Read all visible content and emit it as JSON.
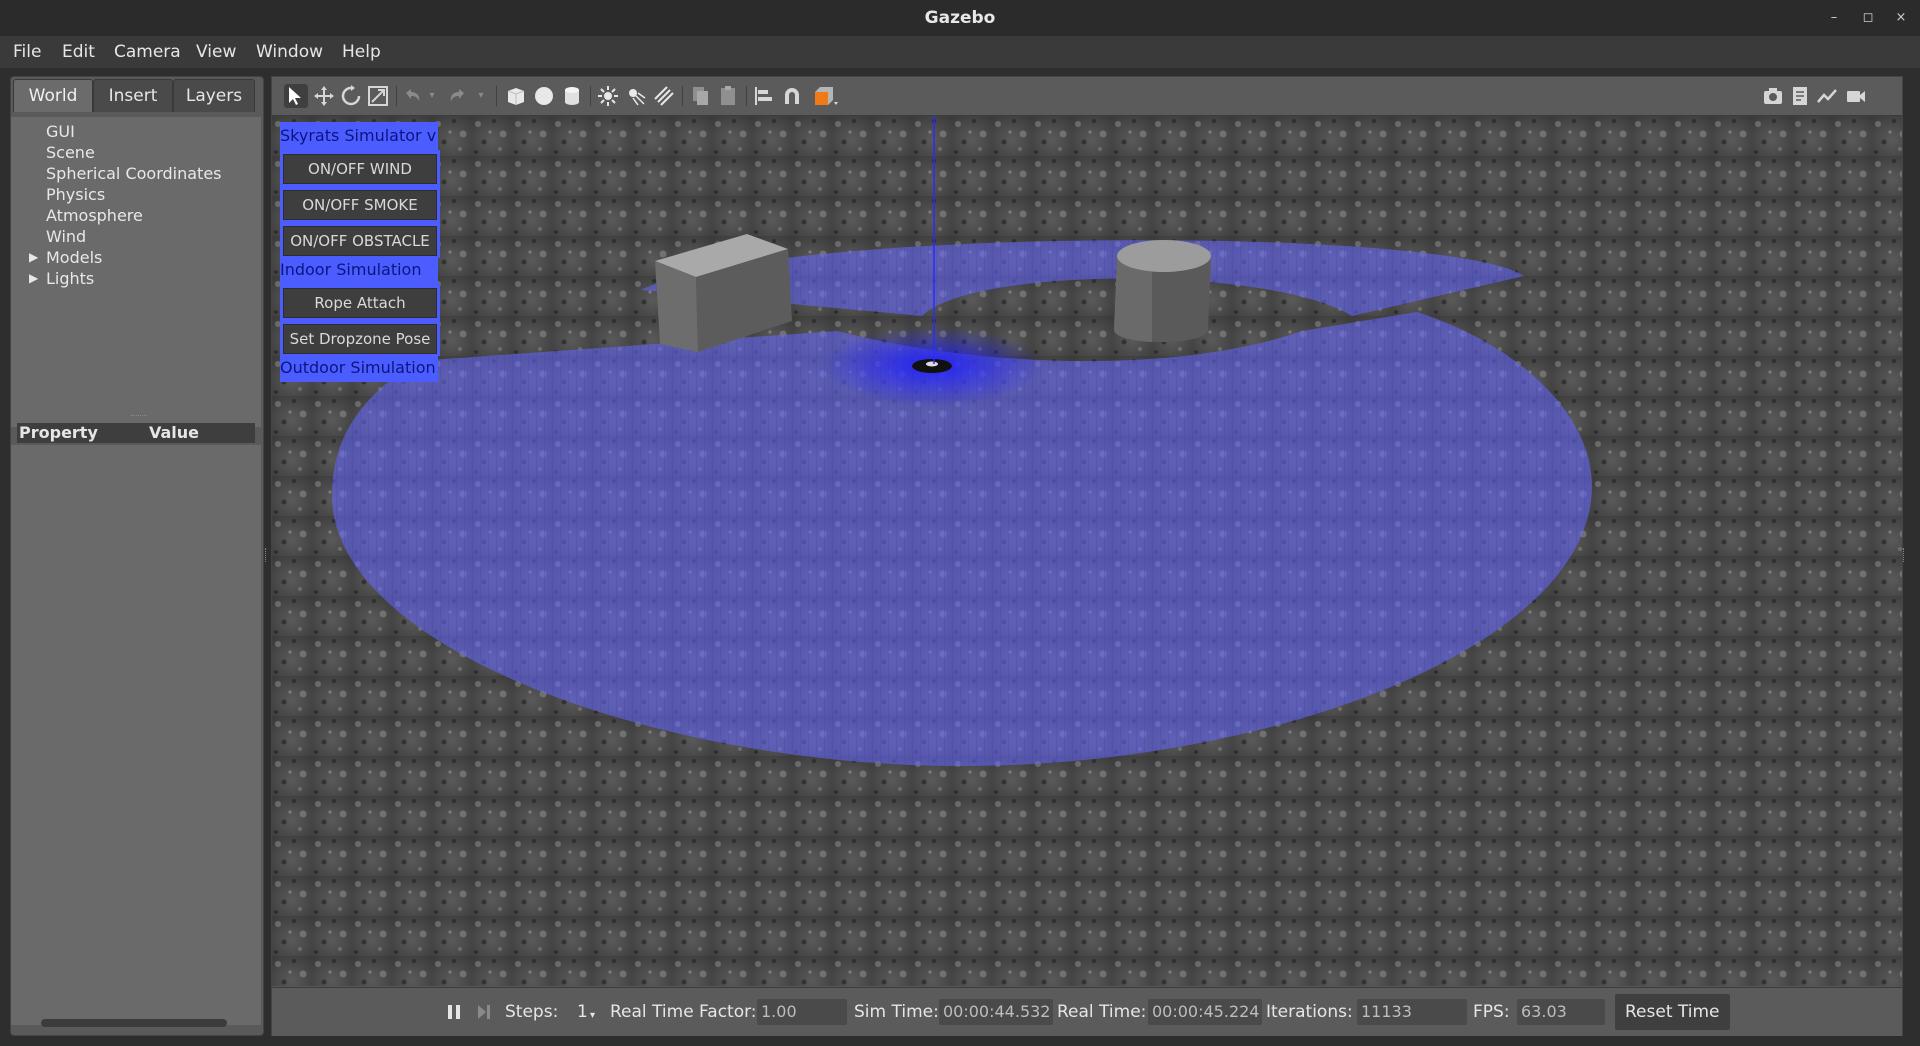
{
  "window": {
    "title": "Gazebo",
    "controls": [
      "–",
      "◻",
      "×"
    ]
  },
  "menubar": [
    {
      "label": "File"
    },
    {
      "label": "Edit"
    },
    {
      "label": "Camera"
    },
    {
      "label": "View"
    },
    {
      "label": "Window"
    },
    {
      "label": "Help"
    }
  ],
  "left_panel": {
    "tabs": [
      {
        "label": "World",
        "active": true
      },
      {
        "label": "Insert",
        "active": false
      },
      {
        "label": "Layers",
        "active": false
      }
    ],
    "tree": [
      "GUI",
      "Scene",
      "Spherical Coordinates",
      "Physics",
      "Atmosphere",
      "Wind",
      "Models",
      "Lights"
    ],
    "expandable": [
      "Models",
      "Lights"
    ],
    "properties_header": {
      "property": "Property",
      "value": "Value"
    }
  },
  "toolbar": {
    "icons": [
      "select-arrow-icon",
      "translate-icon",
      "rotate-icon",
      "scale-icon",
      "undo-icon",
      "undo-dropdown-icon",
      "redo-icon",
      "redo-dropdown-icon",
      "box-shape-icon",
      "sphere-shape-icon",
      "cylinder-shape-icon",
      "point-light-icon",
      "spot-light-icon",
      "directional-light-icon",
      "copy-icon",
      "paste-icon",
      "align-icon",
      "snap-icon",
      "view-angle-icon",
      "screenshot-icon",
      "log-icon",
      "plot-icon",
      "record-video-icon"
    ]
  },
  "overlay": {
    "title": "Skyrats Simulator v",
    "buttons_group1": [
      "ON/OFF WIND",
      "ON/OFF SMOKE",
      "ON/OFF OBSTACLE"
    ],
    "section_indoor": "Indoor Simulation",
    "buttons_group2": [
      "Rope Attach",
      "Set Dropzone Pose"
    ],
    "section_outdoor": "Outdoor Simulation"
  },
  "statusbar": {
    "steps_label": "Steps:",
    "steps_value": "1",
    "rtf_label": "Real Time Factor:",
    "rtf_value": "1.00",
    "sim_time_label": "Sim Time:",
    "sim_time_value": "00:00:44.532",
    "real_time_label": "Real Time:",
    "real_time_value": "00:00:45.224",
    "iterations_label": "Iterations:",
    "iterations_value": "11133",
    "fps_label": "FPS:",
    "fps_value": "63.03",
    "reset_label": "Reset Time"
  },
  "colors": {
    "overlay_blue": "#4c5dff",
    "laser_fan": "#5b5cff",
    "ground": "#4f4f4f"
  }
}
